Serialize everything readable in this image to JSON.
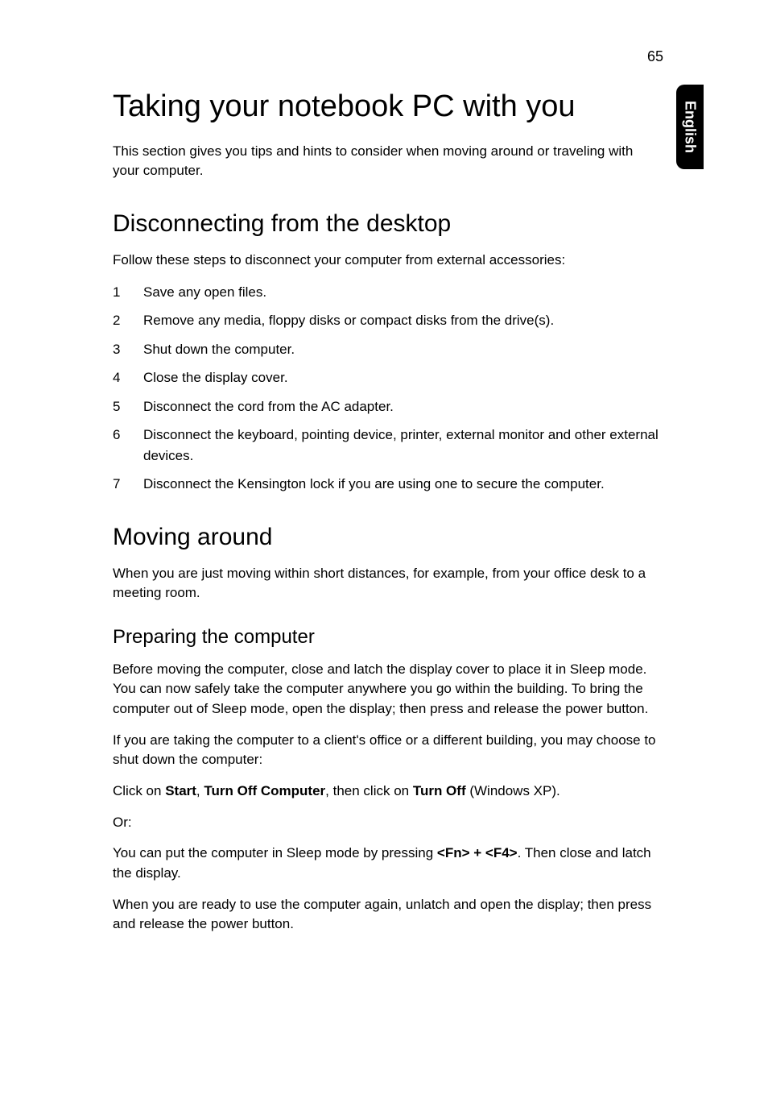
{
  "page_number": "65",
  "side_tab": "English",
  "h1": "Taking your notebook PC with you",
  "intro": "This section gives you tips and hints to consider when moving around or traveling with your computer.",
  "section_disconnect": {
    "heading": "Disconnecting from the desktop",
    "lead": "Follow these steps to disconnect your computer from external accessories:",
    "steps": [
      {
        "n": "1",
        "t": "Save any open files."
      },
      {
        "n": "2",
        "t": "Remove any media, floppy disks or compact disks from the drive(s)."
      },
      {
        "n": "3",
        "t": "Shut down the computer."
      },
      {
        "n": "4",
        "t": "Close the display cover."
      },
      {
        "n": "5",
        "t": "Disconnect the cord from the AC adapter."
      },
      {
        "n": "6",
        "t": "Disconnect the keyboard, pointing device, printer, external monitor and other external devices."
      },
      {
        "n": "7",
        "t": "Disconnect the Kensington lock if you are using one to secure the computer."
      }
    ]
  },
  "section_moving": {
    "heading": "Moving around",
    "lead": "When you are just moving within short distances, for example, from your office desk to a meeting room.",
    "sub_heading": "Preparing the computer",
    "para1": "Before moving the computer, close and latch the display cover to place it in Sleep mode. You can now safely take the computer anywhere you go within the building. To bring the computer out of Sleep mode, open the display; then press and release the power button.",
    "para2": "If you are taking the computer to a client's office or a different building, you may choose to shut down the computer:",
    "click_line": {
      "pre": "Click on ",
      "b1": "Start",
      "mid1": ", ",
      "b2": "Turn Off Computer",
      "mid2": ", then click on ",
      "b3": "Turn Off",
      "post": " (Windows XP)."
    },
    "or": "Or:",
    "sleep_line": {
      "pre": "You can put the computer in Sleep mode by pressing ",
      "keys": "<Fn> + <F4>",
      "post": ". Then close and latch the display."
    },
    "para_last": "When you are ready to use the computer again, unlatch and open the display; then press and release the power button."
  }
}
